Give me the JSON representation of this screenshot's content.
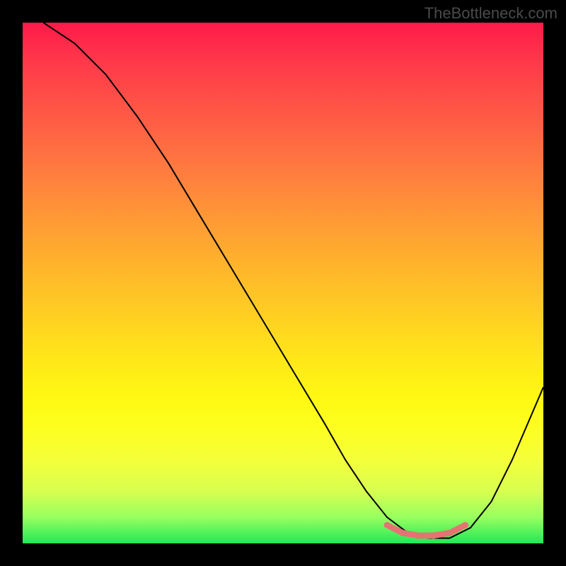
{
  "watermark": "TheBottleneck.com",
  "chart_data": {
    "type": "line",
    "title": "",
    "xlabel": "",
    "ylabel": "",
    "xlim": [
      0,
      100
    ],
    "ylim": [
      0,
      100
    ],
    "series": [
      {
        "name": "curve",
        "color": "#000000",
        "x": [
          4,
          10,
          16,
          22,
          28,
          34,
          40,
          46,
          52,
          58,
          62,
          66,
          70,
          74,
          78,
          82,
          86,
          90,
          94,
          100
        ],
        "y": [
          100,
          96,
          90,
          82,
          73,
          63,
          53,
          43,
          33,
          23,
          16,
          10,
          5,
          2,
          1,
          1,
          3,
          8,
          16,
          30
        ]
      },
      {
        "name": "highlight",
        "color": "#e57373",
        "style": "dotted-thick",
        "x": [
          70,
          73,
          76,
          79,
          82,
          85
        ],
        "y": [
          3.5,
          2,
          1.5,
          1.5,
          2,
          3.5
        ]
      }
    ]
  }
}
